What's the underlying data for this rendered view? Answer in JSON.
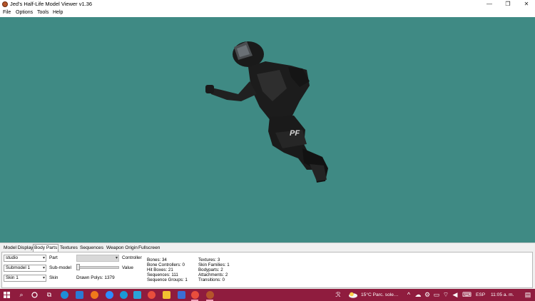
{
  "window": {
    "title": "Jed's Half-Life Model Viewer v1.36",
    "minimize_glyph": "—",
    "restore_glyph": "❐",
    "close_glyph": "✕"
  },
  "menu": [
    "File",
    "Options",
    "Tools",
    "Help"
  ],
  "viewport": {
    "background": "#3f8a84",
    "model_badge": "PF"
  },
  "tabs": [
    "Model Display",
    "Body Parts",
    "Textures",
    "Sequences",
    "Weapon Origin",
    "Fullscreen"
  ],
  "active_tab": "Body Parts",
  "body_parts": {
    "part_value": "studio",
    "part_label": "Part",
    "submodel_value": "Submodel 1",
    "submodel_label": "Sub-model",
    "skin_value": "Skin 1",
    "skin_label": "Skin",
    "controller_label": "Controller",
    "value_label": "Value",
    "drawn_polys": "Drawn Polys: 1379"
  },
  "stats_left": [
    "Bones: 34",
    "Bone Controllers: 0",
    "Hit Boxes: 21",
    "Sequences: 111",
    "Sequence Groups: 1"
  ],
  "stats_right": [
    "Textures: 3",
    "Skin Families: 1",
    "Bodyparts: 2",
    "Attachments: 2",
    "Transitions: 0"
  ],
  "taskbar": {
    "background": "#8f1c3e",
    "weather": "15°C  Parc. sole…",
    "language": "ESP",
    "time": "11:05 a. m.",
    "apps": [
      "windows-start",
      "search",
      "cortana",
      "task-view",
      "edge",
      "mail",
      "firefox",
      "zoom",
      "chat",
      "l-app",
      "chrome",
      "file-explorer",
      "photos",
      "chrome-active",
      "model-viewer"
    ]
  }
}
